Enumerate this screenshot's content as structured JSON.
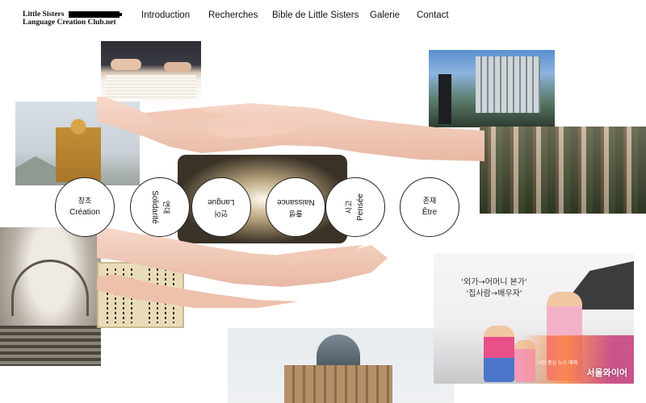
{
  "header": {
    "logo": {
      "line1": "Little Sisters",
      "line2": "Language Creation Club.net"
    },
    "nav": [
      {
        "label": "Introduction"
      },
      {
        "label": "Recherches"
      },
      {
        "label": "Bible de Little Sisters"
      },
      {
        "label": "Galerie"
      },
      {
        "label": "Contact"
      }
    ]
  },
  "circles": [
    {
      "ko": "창조",
      "fr": "Création",
      "orientation": "upright"
    },
    {
      "ko": "연대",
      "fr": "Solidarité",
      "orientation": "rotated-90"
    },
    {
      "ko": "언어",
      "fr": "Langue",
      "orientation": "rotated-180"
    },
    {
      "ko": "출생",
      "fr": "Naissance",
      "orientation": "rotated-180"
    },
    {
      "ko": "사고",
      "fr": "Pensée",
      "orientation": "rotated-minus-90"
    },
    {
      "ko": "존재",
      "fr": "Être",
      "orientation": "upright"
    }
  ],
  "ad": {
    "line1": "'외가→어머니 본가'",
    "line2": "'집사람→배우자'",
    "brand": "서울와이어",
    "brand_sub": "시민 중심 뉴스 매체"
  },
  "colors": {
    "background": "#ffffff",
    "text": "#111111",
    "circle_border": "#222222"
  }
}
